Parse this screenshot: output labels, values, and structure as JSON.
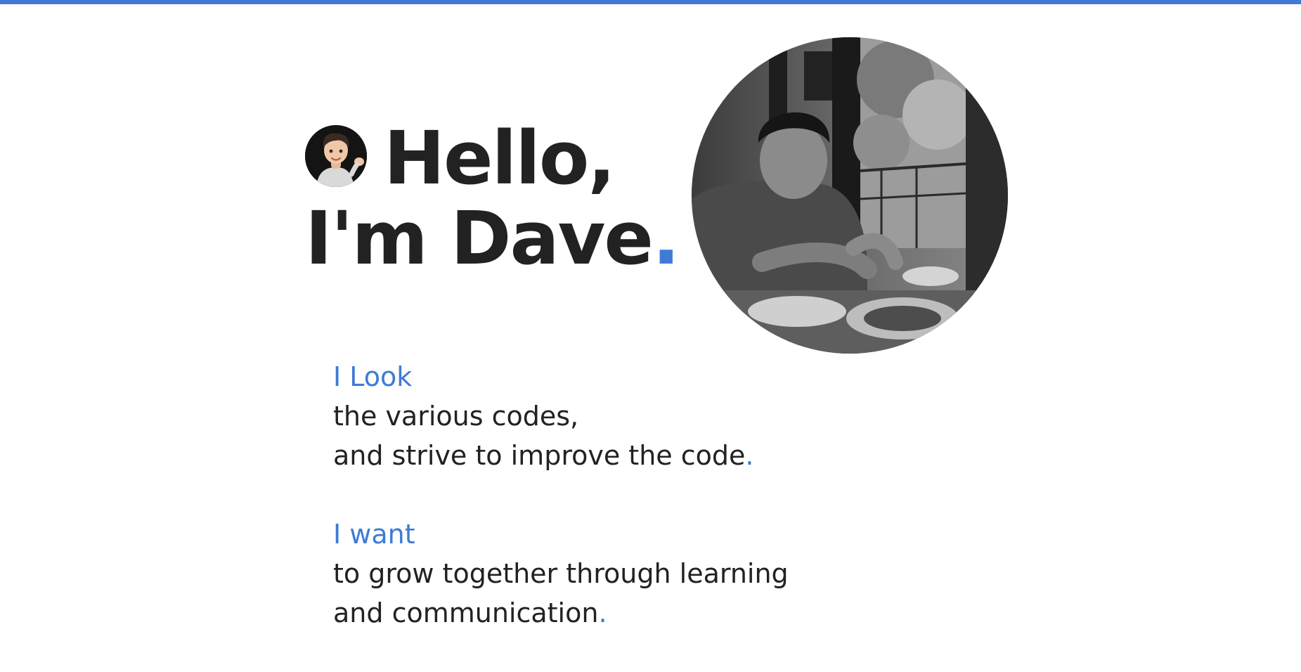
{
  "colors": {
    "accent": "#3f7bd6",
    "text": "#222222",
    "background": "#ffffff"
  },
  "icons": {
    "avatar": "memoji-avatar-icon"
  },
  "hero": {
    "greeting": "Hello,",
    "intro_prefix": "I'm Dave",
    "dot": "."
  },
  "intro": {
    "blocks": [
      {
        "heading": "I Look",
        "lines": [
          "the various codes,",
          "and strive to improve the code"
        ],
        "dot": "."
      },
      {
        "heading": "I want",
        "lines": [
          "to grow together through learning",
          "and communication"
        ],
        "dot": "."
      }
    ]
  }
}
